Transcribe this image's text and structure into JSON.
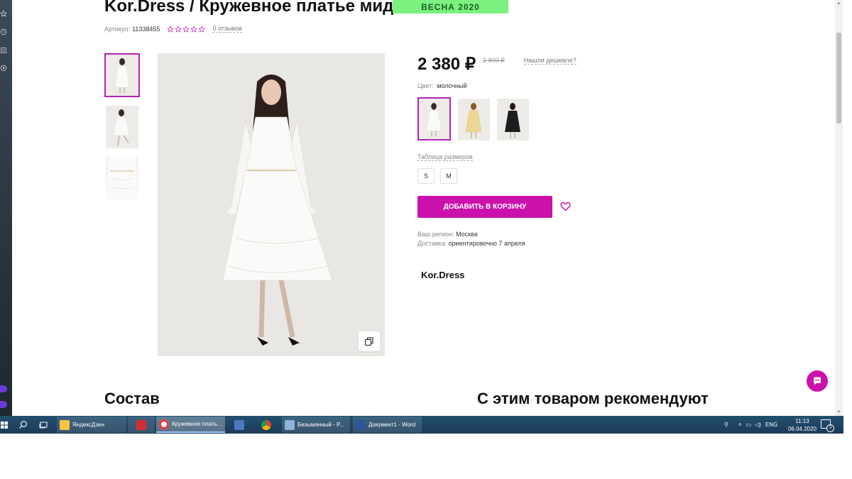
{
  "product": {
    "title": "Kor.Dress / Кружевное платье миди",
    "badge": "ВЕСНА 2020",
    "sku_label": "Артикул:",
    "sku_value": "11338455",
    "reviews": "0 отзывов",
    "rating_stars": 0
  },
  "price": {
    "current": "2 380 ₽",
    "old": "2 800 ₽",
    "cheaper_link": "Нашли дешевле?"
  },
  "color": {
    "label": "Цвет:",
    "value": "молочный",
    "swatches": [
      "milk",
      "yellow",
      "black"
    ]
  },
  "sizes": {
    "table_link": "Таблица размеров",
    "options": [
      "S",
      "M"
    ]
  },
  "cart": {
    "add_label": "ДОБАВИТЬ В КОРЗИНУ"
  },
  "delivery": {
    "region_label": "Ваш регион:",
    "region_value": "Москва",
    "delivery_label": "Доставка:",
    "delivery_value": "ориентировочно 7 апреля"
  },
  "brand_logo": "Kor.Dress",
  "sections": {
    "composition": "Состав",
    "recommended": "С этим товаром рекомендуют"
  },
  "taskbar": {
    "tasks": [
      {
        "label": "ЯндексДзен"
      },
      {
        "label": ""
      },
      {
        "label": "Кружевное плать..."
      },
      {
        "label": ""
      },
      {
        "label": ""
      },
      {
        "label": "Безымянный - P..."
      },
      {
        "label": "Документ1 - Word"
      }
    ],
    "language": "ENG",
    "time": "11:13",
    "date": "06.04.2020",
    "notifications": "3"
  },
  "colors": {
    "accent": "#cb11ab",
    "badge_bg": "#7bf27f",
    "taskbar": "#1d3a5a"
  }
}
